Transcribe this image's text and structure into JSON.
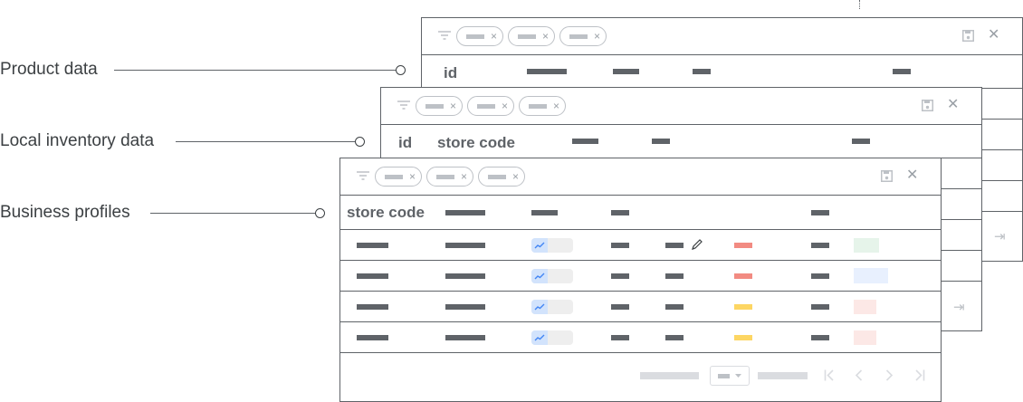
{
  "labels": {
    "product": "Product data",
    "inventory": "Local inventory data",
    "business": "Business profiles"
  },
  "panels": {
    "product": {
      "header_key": "id"
    },
    "inventory": {
      "header_key": "id",
      "header_key2": "store code"
    },
    "business": {
      "header_key": "store code"
    }
  },
  "colors": {
    "text": "#3c4043",
    "border": "#5f6368",
    "chip": "#bdc1c6",
    "red": "#f28b82",
    "yellow": "#fdd663",
    "green": "#e6f4ea",
    "blue": "#e8f0fe",
    "pink": "#fce8e6"
  },
  "rows": [
    {
      "swatch": "red",
      "status": "green",
      "editable": true
    },
    {
      "swatch": "red",
      "status": "blue",
      "editable": false
    },
    {
      "swatch": "yellow",
      "status": "pink",
      "editable": false
    },
    {
      "swatch": "yellow",
      "status": "pink",
      "editable": false
    }
  ],
  "icons": {
    "filter": "filter-icon",
    "save": "save-icon",
    "close": "close-icon",
    "edit": "pencil-icon",
    "trend": "trend-icon",
    "first_page": "first-page-icon",
    "prev_page": "chevron-left-icon",
    "next_page": "chevron-right-icon",
    "last_page": "last-page-icon",
    "dropdown": "dropdown-icon"
  }
}
